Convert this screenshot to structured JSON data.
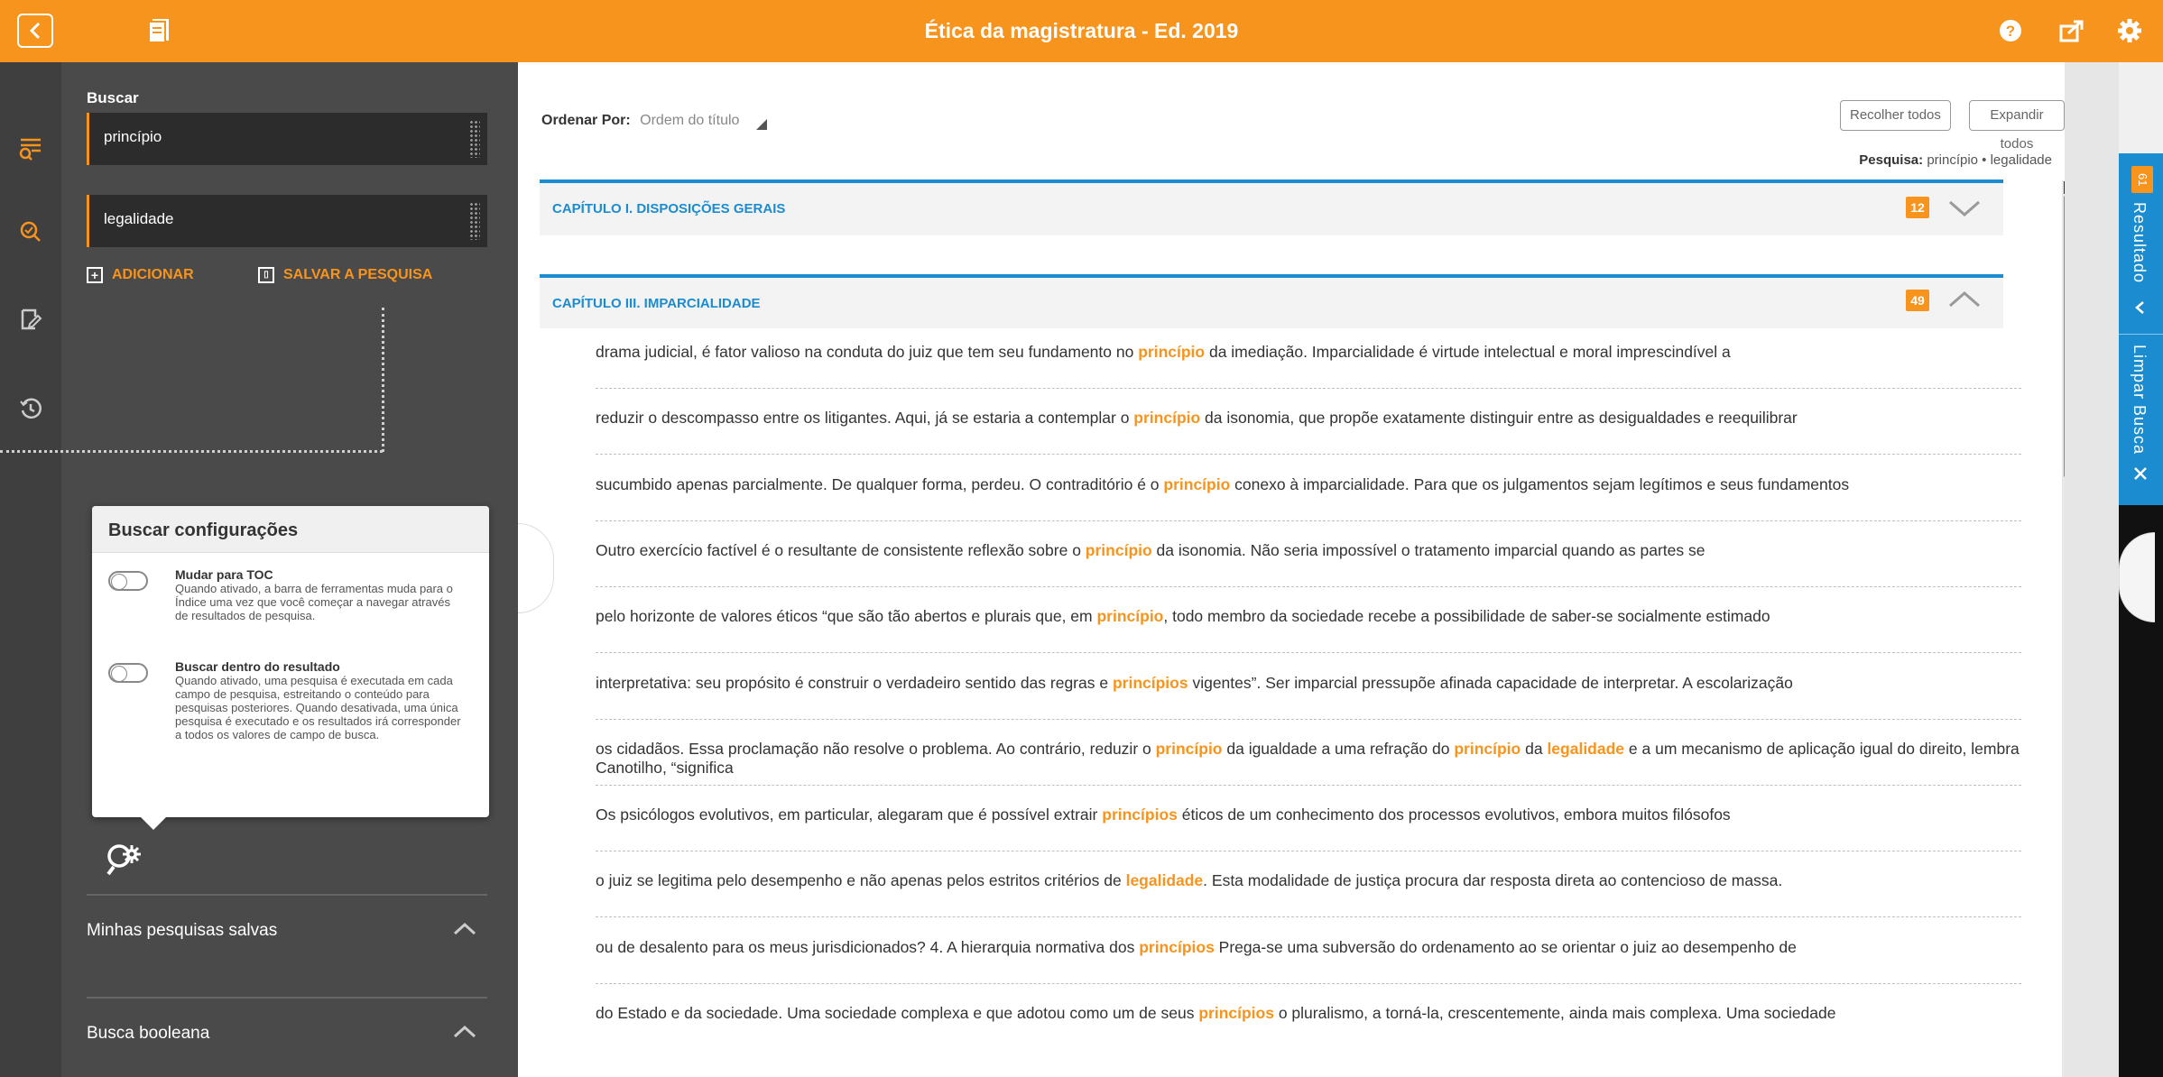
{
  "app": {
    "title": "Ética da magistratura - Ed. 2019",
    "accent": "#f7941d",
    "link_color": "#1a8ccf"
  },
  "topbar": {
    "back_icon": "chevron-left-icon",
    "book_icon": "book-icon",
    "help_icon": "help-icon",
    "share_icon": "share-icon",
    "settings_icon": "gear-icon"
  },
  "rail": {
    "icons": [
      "toc-search-icon",
      "search-icon",
      "edit-note-icon",
      "history-icon"
    ]
  },
  "search_panel": {
    "label": "Buscar",
    "fields": [
      {
        "value": "princípio"
      },
      {
        "value": "legalidade"
      }
    ],
    "add_label": "ADICIONAR",
    "save_label": "SALVAR A PESQUISA"
  },
  "config": {
    "title": "Buscar configurações",
    "options": [
      {
        "title": "Mudar para TOC",
        "desc": "Quando ativado, a barra de ferramentas muda para o Índice uma vez que você começar a navegar através de resultados de pesquisa."
      },
      {
        "title": "Buscar dentro do resultado",
        "desc": "Quando ativado, uma pesquisa é executada em cada campo de pesquisa, estreitando o conteúdo para pesquisas posteriores. Quando desativada, uma única pesquisa é executado e os resultados irá corresponder a todos os valores de campo de busca."
      }
    ]
  },
  "sections": {
    "saved": "Minhas pesquisas salvas",
    "boolean": "Busca booleana"
  },
  "main": {
    "sort_label": "Ordenar Por:",
    "sort_value": "Ordem do título",
    "collapse_all": "Recolher todos",
    "expand_all": "Expandir todos",
    "pesquisa_label": "Pesquisa:",
    "pesquisa_value": "princípio • legalidade",
    "chapters": [
      {
        "title": "CAPÍTULO I. DISPOSIÇÕES GERAIS",
        "count": "12",
        "expanded": false
      },
      {
        "title": "CAPÍTULO III. IMPARCIALIDADE",
        "count": "49",
        "expanded": true
      }
    ],
    "results": [
      [
        {
          "t": "drama judicial, é fator valioso na conduta do juiz que tem seu fundamento no "
        },
        {
          "h": "princípio"
        },
        {
          "t": " da imediação. Imparcialidade é virtude intelectual e moral imprescindível a"
        }
      ],
      [
        {
          "t": "reduzir o descompasso entre os litigantes. Aqui, já se estaria a contemplar o "
        },
        {
          "h": "princípio"
        },
        {
          "t": " da isonomia, que propõe exatamente distinguir entre as desigualdades e reequilibrar"
        }
      ],
      [
        {
          "t": "sucumbido apenas parcialmente. De qualquer forma, perdeu. O contraditório é o "
        },
        {
          "h": "princípio"
        },
        {
          "t": " conexo à imparcialidade. Para que os julgamentos sejam legítimos e seus fundamentos"
        }
      ],
      [
        {
          "t": "Outro exercício factível é o resultante de consistente reflexão sobre o "
        },
        {
          "h": "princípio"
        },
        {
          "t": " da isonomia. Não seria impossível o tratamento imparcial quando as partes se"
        }
      ],
      [
        {
          "t": "pelo horizonte de valores éticos “que são tão abertos e plurais que, em "
        },
        {
          "h": "princípio"
        },
        {
          "t": ", todo membro da sociedade recebe a possibilidade de saber-se socialmente estimado"
        }
      ],
      [
        {
          "t": "interpretativa: seu propósito é construir o verdadeiro sentido das regras e "
        },
        {
          "h": "princípios"
        },
        {
          "t": " vigentes”. Ser imparcial pressupõe afinada capacidade de interpretar. A escolarização"
        }
      ],
      [
        {
          "t": "os cidadãos. Essa proclamação não resolve o problema. Ao contrário, reduzir o "
        },
        {
          "h": "princípio"
        },
        {
          "t": " da igualdade a uma refração do "
        },
        {
          "h": "princípio"
        },
        {
          "t": " da "
        },
        {
          "h": "legalidade"
        },
        {
          "t": " e a um mecanismo de aplicação igual do direito, lembra Canotilho, “significa"
        }
      ],
      [
        {
          "t": "Os psicólogos evolutivos, em particular, alegaram que é possível extrair "
        },
        {
          "h": "princípios"
        },
        {
          "t": " éticos de um conhecimento dos processos evolutivos, embora muitos filósofos"
        }
      ],
      [
        {
          "t": "o juiz se legitima pelo desempenho e não apenas pelos estritos critérios de "
        },
        {
          "h": "legalidade"
        },
        {
          "t": ". Esta modalidade de justiça procura dar resposta direta ao contencioso de massa."
        }
      ],
      [
        {
          "t": "ou de desalento para os meus jurisdicionados? 4. A hierarquia normativa dos "
        },
        {
          "h": "princípios"
        },
        {
          "t": " Prega-se uma subversão do ordenamento ao se orientar o juiz ao desempenho de"
        }
      ],
      [
        {
          "t": "do Estado e da sociedade. Uma sociedade complexa e que adotou como um de seus "
        },
        {
          "h": "princípios"
        },
        {
          "t": " o pluralismo, a torná-la, crescentemente, ainda mais complexa. Uma sociedade"
        }
      ]
    ]
  },
  "right_tab": {
    "count": "61",
    "results_label": "Resultado",
    "clear_label": "Limpar Busca",
    "chevron_icon": "chevron-left-icon",
    "close_icon": "close-icon"
  }
}
